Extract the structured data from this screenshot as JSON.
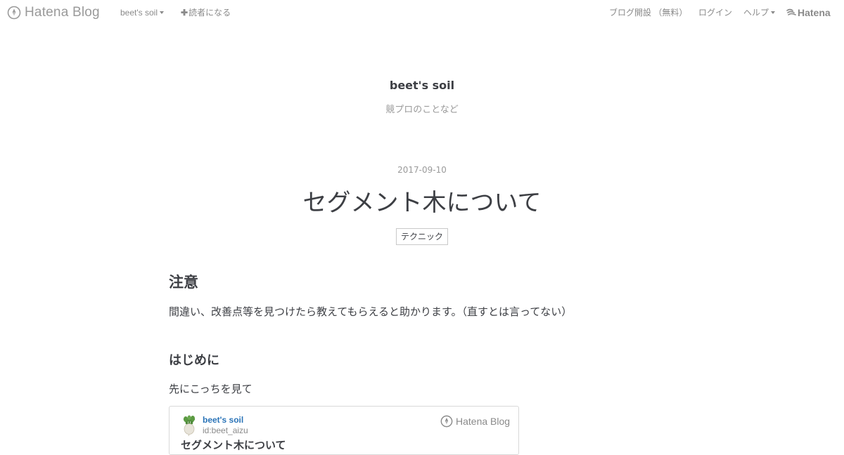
{
  "topbar": {
    "logo_text": "Hatena Blog",
    "blog_menu": "beet's soil",
    "subscribe": "読者になる",
    "create_blog": "ブログ開設 （無料）",
    "login": "ログイン",
    "help": "ヘルプ",
    "hatena_logo": "Hatena",
    "icons": {
      "logo": "hatena-blog-pen-icon",
      "caret": "chevron-down-icon",
      "plus": "plus-icon",
      "hatena": "hatena-bird-icon"
    }
  },
  "blog": {
    "title": "beet's soil",
    "description": "競プロのことなど"
  },
  "entry": {
    "date": "2017-09-10",
    "title": "セグメント木について",
    "category": "テクニック",
    "section1_heading": "注意",
    "section1_text": "間違い、改善点等を見つけたら教えてもらえると助かります。（直すとは言ってない）",
    "section2_heading": "はじめに",
    "section2_text": "先にこっちを見て"
  },
  "embed": {
    "blog_name": "beet's soil",
    "user_id": "id:beet_aizu",
    "service_logo": "Hatena Blog",
    "entry_title": "セグメント木について"
  },
  "colors": {
    "text": "#3d3f44",
    "muted": "#9a9a9a",
    "link": "#2b74b8",
    "border": "#d9d9d9"
  }
}
